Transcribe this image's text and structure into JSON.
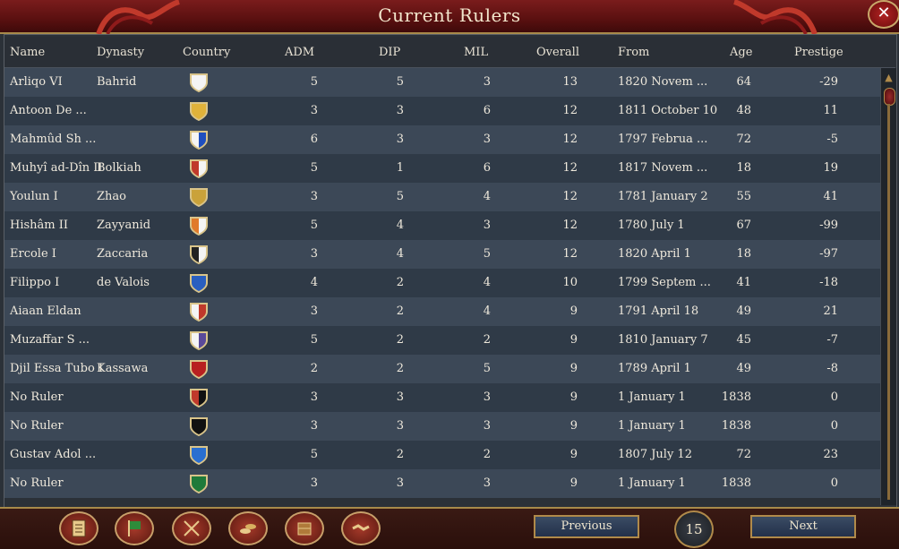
{
  "window": {
    "title": "Current Rulers",
    "close_label": "✕"
  },
  "columns": {
    "name": "Name",
    "dynasty": "Dynasty",
    "country": "Country",
    "adm": "ADM",
    "dip": "DIP",
    "mil": "MIL",
    "overall": "Overall",
    "from": "From",
    "age": "Age",
    "prestige": "Prestige"
  },
  "rows": [
    {
      "name": "Arliqo VI",
      "dynasty": "Bahrid",
      "shield": "white",
      "adm": "5",
      "dip": "5",
      "mil": "3",
      "overall": "13",
      "from": "1820 Novem ...",
      "age": "64",
      "prestige": "-29"
    },
    {
      "name": "Antoon De ...",
      "dynasty": "",
      "shield": "gold",
      "adm": "3",
      "dip": "3",
      "mil": "6",
      "overall": "12",
      "from": "1811 October 10",
      "age": "48",
      "prestige": "11"
    },
    {
      "name": "Mahmûd Sh ...",
      "dynasty": "",
      "shield": "white-blue",
      "adm": "6",
      "dip": "3",
      "mil": "3",
      "overall": "12",
      "from": "1797 Februa ...",
      "age": "72",
      "prestige": "-5"
    },
    {
      "name": "Muhyî ad-Dîn II",
      "dynasty": "Bolkiah",
      "shield": "red-white",
      "adm": "5",
      "dip": "1",
      "mil": "6",
      "overall": "12",
      "from": "1817 Novem ...",
      "age": "18",
      "prestige": "19"
    },
    {
      "name": "Youlun I",
      "dynasty": "Zhao",
      "shield": "gold-dark",
      "adm": "3",
      "dip": "5",
      "mil": "4",
      "overall": "12",
      "from": "1781 January 2",
      "age": "55",
      "prestige": "41"
    },
    {
      "name": "Hishâm II",
      "dynasty": "Zayyanid",
      "shield": "orange",
      "adm": "5",
      "dip": "4",
      "mil": "3",
      "overall": "12",
      "from": "1780 July 1",
      "age": "67",
      "prestige": "-99"
    },
    {
      "name": "Ercole I",
      "dynasty": "Zaccaria",
      "shield": "black-white",
      "adm": "3",
      "dip": "4",
      "mil": "5",
      "overall": "12",
      "from": "1820 April 1",
      "age": "18",
      "prestige": "-97"
    },
    {
      "name": "Filippo I",
      "dynasty": "de Valois",
      "shield": "blue-gold",
      "adm": "4",
      "dip": "2",
      "mil": "4",
      "overall": "10",
      "from": "1799 Septem ...",
      "age": "41",
      "prestige": "-18"
    },
    {
      "name": "Aiaan Eldan",
      "dynasty": "",
      "shield": "white-red",
      "adm": "3",
      "dip": "2",
      "mil": "4",
      "overall": "9",
      "from": "1791 April 18",
      "age": "49",
      "prestige": "21"
    },
    {
      "name": "Muzaffar S ...",
      "dynasty": "",
      "shield": "white-purple",
      "adm": "5",
      "dip": "2",
      "mil": "2",
      "overall": "9",
      "from": "1810 January 7",
      "age": "45",
      "prestige": "-7"
    },
    {
      "name": "Djil Essa Tubo I",
      "dynasty": "Kassawa",
      "shield": "red-gold",
      "adm": "2",
      "dip": "2",
      "mil": "5",
      "overall": "9",
      "from": "1789 April 1",
      "age": "49",
      "prestige": "-8"
    },
    {
      "name": "No Ruler",
      "dynasty": "",
      "shield": "red-black",
      "adm": "3",
      "dip": "3",
      "mil": "3",
      "overall": "9",
      "from": "1 January 1",
      "age": "1838",
      "prestige": "0"
    },
    {
      "name": "No Ruler",
      "dynasty": "",
      "shield": "pirate",
      "adm": "3",
      "dip": "3",
      "mil": "3",
      "overall": "9",
      "from": "1 January 1",
      "age": "1838",
      "prestige": "0"
    },
    {
      "name": "Gustav Adol ...",
      "dynasty": "",
      "shield": "swedish",
      "adm": "5",
      "dip": "2",
      "mil": "2",
      "overall": "9",
      "from": "1807 July 12",
      "age": "72",
      "prestige": "23"
    },
    {
      "name": "No Ruler",
      "dynasty": "",
      "shield": "green",
      "adm": "3",
      "dip": "3",
      "mil": "3",
      "overall": "9",
      "from": "1 January 1",
      "age": "1838",
      "prestige": "0"
    }
  ],
  "toolbar": {
    "buttons": [
      "scroll-icon",
      "flag-icon",
      "crossed-swords-icon",
      "coins-icon",
      "crate-icon",
      "handshake-icon"
    ]
  },
  "pagination": {
    "previous_label": "Previous",
    "next_label": "Next",
    "page": "15"
  },
  "colors": {
    "title_red": "#6a1414",
    "row_odd": "#3c4857",
    "row_even": "#2f3a47",
    "gold_trim": "#b08a4a"
  }
}
